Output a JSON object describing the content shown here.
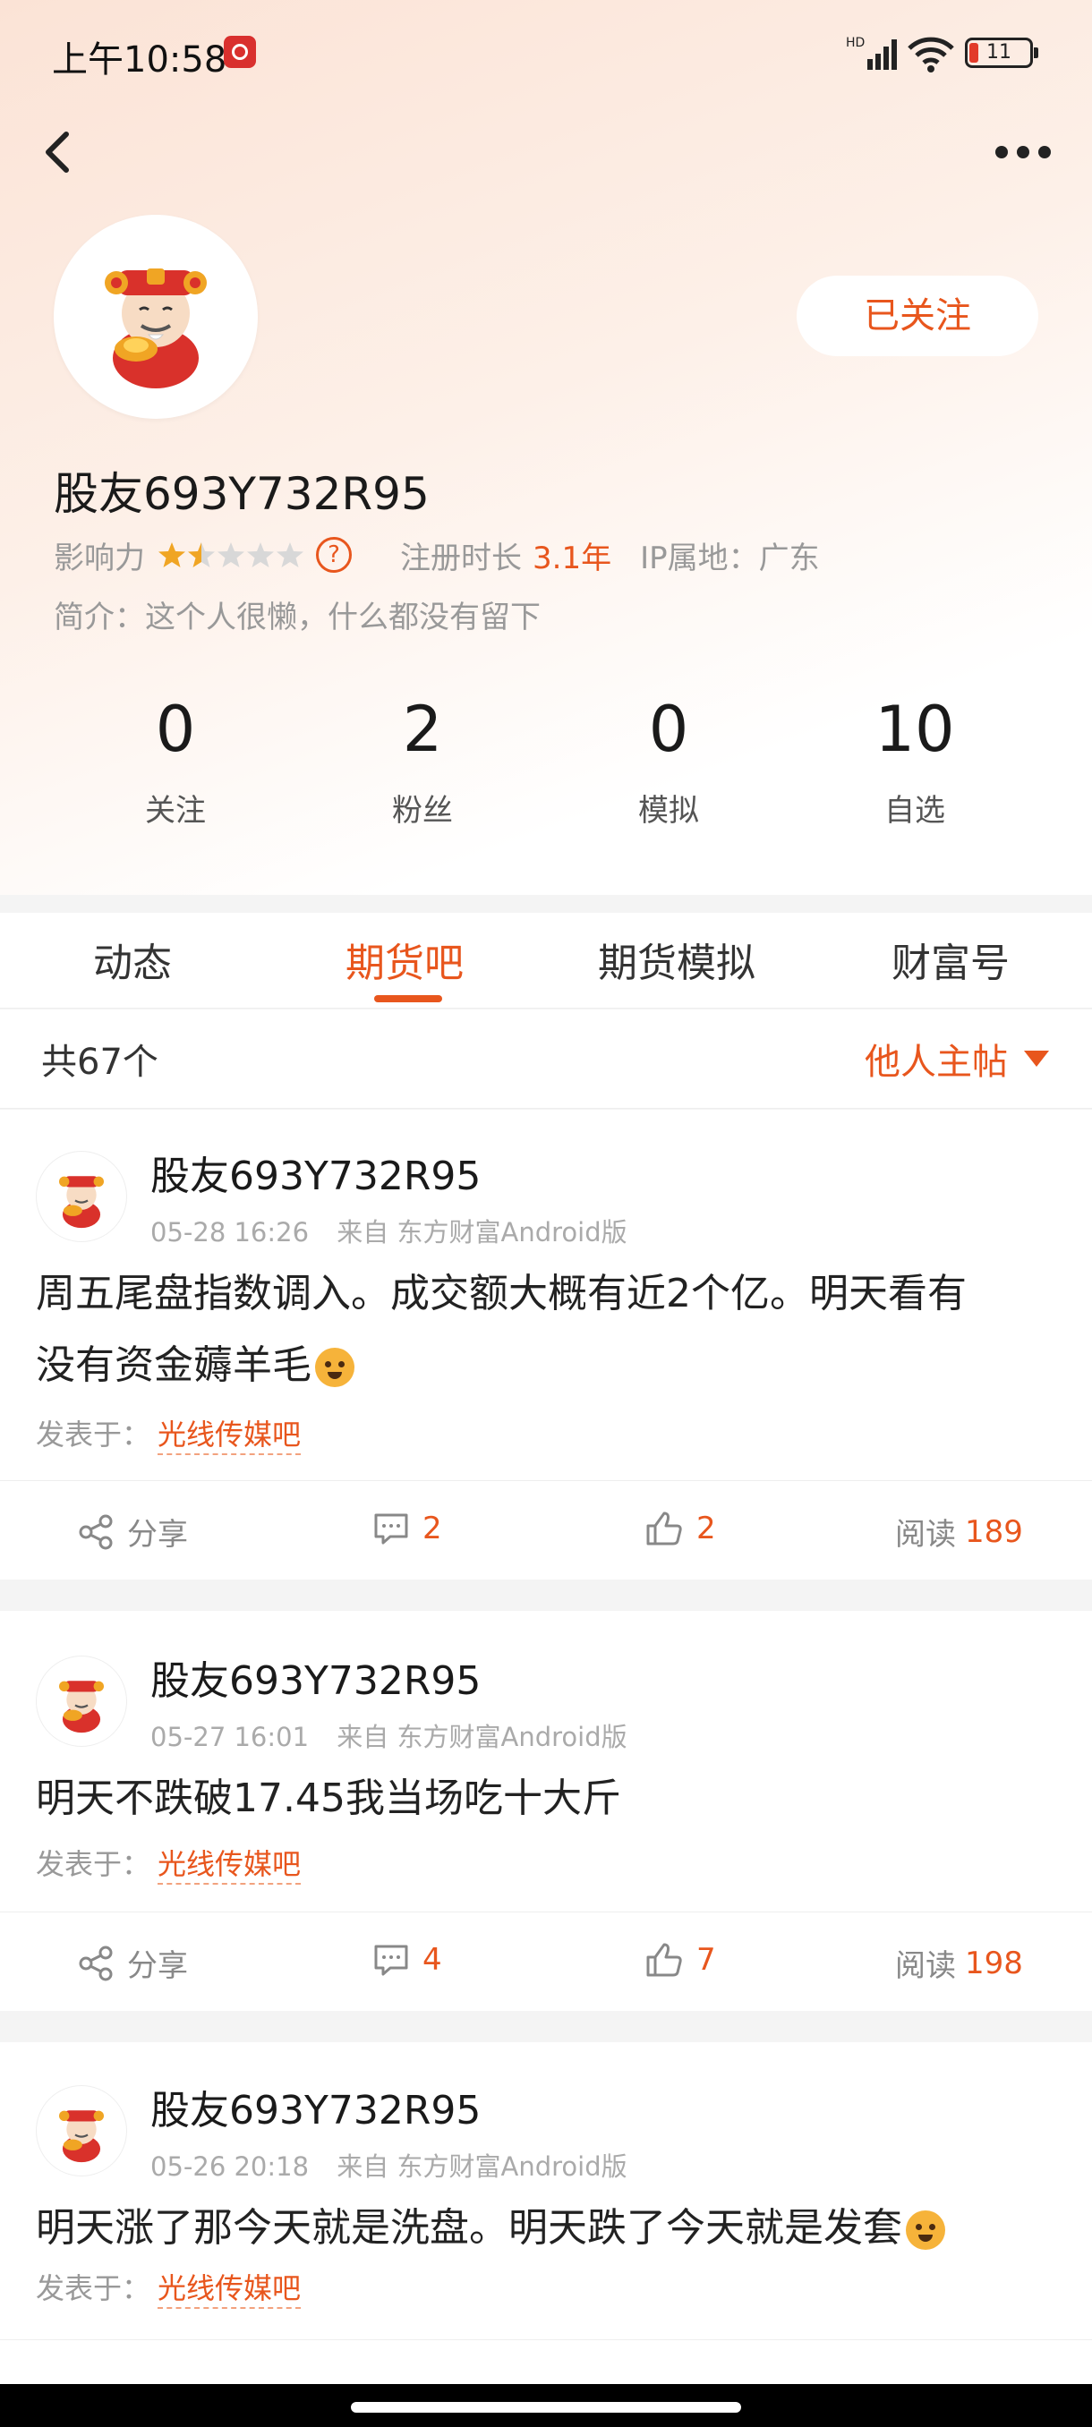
{
  "status_bar": {
    "time": "上午10:58",
    "network": "HD",
    "battery": "11"
  },
  "profile": {
    "follow_button": "已关注",
    "username": "股友693Y732R95",
    "influence_label": "影响力",
    "influence_stars": 1.5,
    "help_glyph": "?",
    "reg_label": "注册时长",
    "reg_value": "3.1年",
    "ip_label": "IP属地：广东",
    "intro": "简介：这个人很懒，什么都没有留下"
  },
  "stats": [
    {
      "num": "0",
      "label": "关注"
    },
    {
      "num": "2",
      "label": "粉丝"
    },
    {
      "num": "0",
      "label": "模拟"
    },
    {
      "num": "10",
      "label": "自选"
    }
  ],
  "tabs": [
    {
      "label": "动态",
      "active": false
    },
    {
      "label": "期货吧",
      "active": true
    },
    {
      "label": "期货模拟",
      "active": false
    },
    {
      "label": "财富号",
      "active": false
    }
  ],
  "list_header": {
    "count": "共67个",
    "filter": "他人主帖"
  },
  "posts": [
    {
      "user": "股友693Y732R95",
      "date": "05-28 16:26",
      "source": "来自 东方财富Android版",
      "text_line1": "周五尾盘指数调入。成交额大概有近2个亿。明天看有",
      "text_line2": "没有资金薅羊毛",
      "from_label": "发表于：",
      "bar": "光线传媒吧",
      "share": "分享",
      "comments": "2",
      "likes": "2",
      "read_label": "阅读",
      "reads": "189"
    },
    {
      "user": "股友693Y732R95",
      "date": "05-27 16:01",
      "source": "来自 东方财富Android版",
      "text_line1": "明天不跌破17.45我当场吃十大斤",
      "from_label": "发表于：",
      "bar": "光线传媒吧",
      "share": "分享",
      "comments": "4",
      "likes": "7",
      "read_label": "阅读",
      "reads": "198"
    },
    {
      "user": "股友693Y732R95",
      "date": "05-26 20:18",
      "source": "来自 东方财富Android版",
      "text_line1": "明天涨了那今天就是洗盘。明天跌了今天就是发套",
      "from_label": "发表于：",
      "bar": "光线传媒吧"
    }
  ],
  "colors": {
    "accent": "#e8561d",
    "gold": "#f0a524"
  },
  "icons": [
    "back-arrow-icon",
    "more-icon",
    "share-icon",
    "comment-icon",
    "thumbs-up-icon",
    "caret-down-icon",
    "help-icon",
    "star-icon"
  ]
}
